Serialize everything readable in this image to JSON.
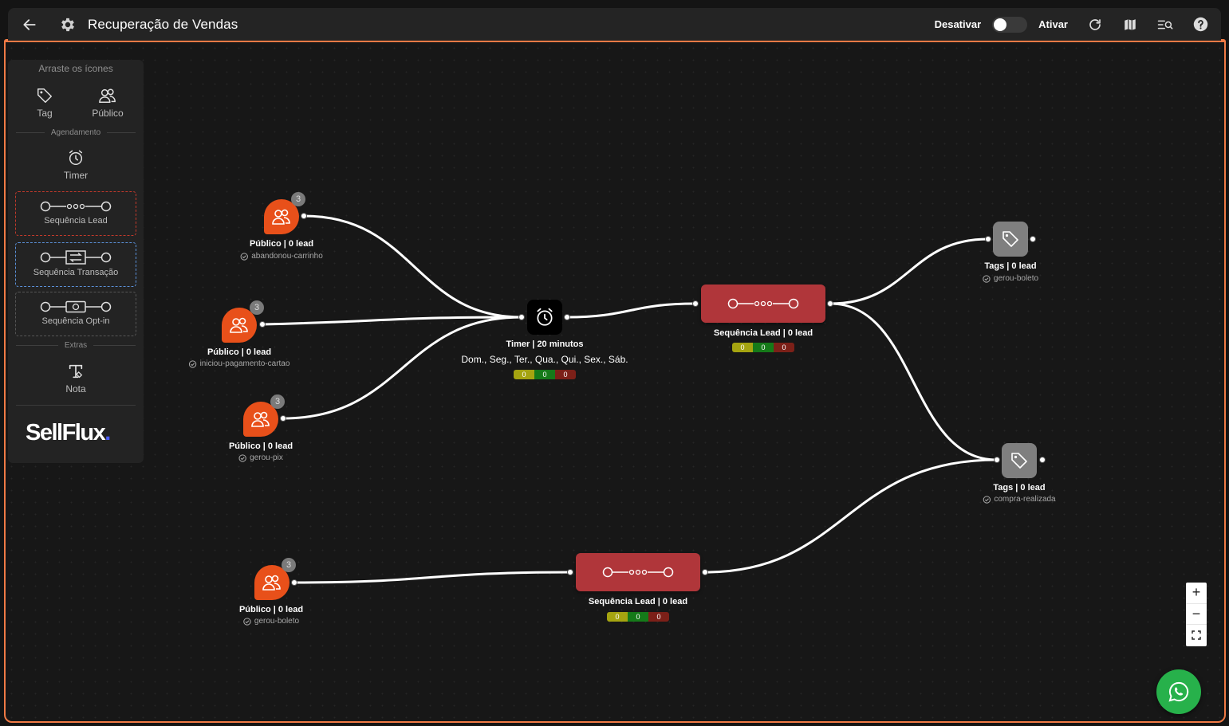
{
  "header": {
    "title": "Recuperação de Vendas",
    "deactivate_label": "Desativar",
    "activate_label": "Ativar",
    "toggle_state": "off",
    "icons": [
      "back-arrow-icon",
      "gear-icon",
      "refresh-icon",
      "map-icon",
      "search-list-icon",
      "help-icon"
    ]
  },
  "palette": {
    "hint": "Arraste os ícones",
    "items": [
      {
        "label": "Tag",
        "icon": "tag-icon"
      },
      {
        "label": "Público",
        "icon": "users-icon"
      }
    ],
    "section_scheduling": "Agendamento",
    "timer_label": "Timer",
    "sequences": [
      {
        "label": "Sequência Lead",
        "icon": "sequence-dots-icon",
        "border_color": "#c0392b"
      },
      {
        "label": "Sequência Transação",
        "icon": "sequence-transaction-icon",
        "border_color": "#5a8fd6"
      },
      {
        "label": "Sequência Opt-in",
        "icon": "sequence-optin-icon",
        "border_color": "#555555"
      }
    ],
    "section_extras": "Extras",
    "note_label": "Nota",
    "logo_text": "SellFlux",
    "logo_dot": "."
  },
  "nodes": {
    "publicos": [
      {
        "badge": "3",
        "label": "Público | 0 lead",
        "sub": "abandonou-carrinho"
      },
      {
        "badge": "3",
        "label": "Público | 0 lead",
        "sub": "iniciou-pagamento-cartao"
      },
      {
        "badge": "3",
        "label": "Público | 0 lead",
        "sub": "gerou-pix"
      },
      {
        "badge": "3",
        "label": "Público | 0 lead",
        "sub": "gerou-boleto"
      }
    ],
    "timer": {
      "label": "Timer | 20 minutos",
      "days": "Dom., Seg., Ter., Qua., Qui., Sex., Sáb.",
      "counters": [
        "0",
        "0",
        "0"
      ]
    },
    "sequences": [
      {
        "label": "Sequência Lead | 0 lead",
        "counters": [
          "0",
          "0",
          "0"
        ]
      },
      {
        "label": "Sequência Lead | 0 lead",
        "counters": [
          "0",
          "0",
          "0"
        ]
      }
    ],
    "tags": [
      {
        "label": "Tags | 0 lead",
        "sub": "gerou-boleto"
      },
      {
        "label": "Tags | 0 lead",
        "sub": "compra-realizada"
      }
    ]
  },
  "colors": {
    "accent_border": "#f07a45",
    "publico_orange": "#e8501a",
    "sequence_red": "#b0363a",
    "tag_gray": "#7f7f7f",
    "whatsapp_green": "#27b14b"
  },
  "zoom": {
    "in": "+",
    "out": "−"
  }
}
